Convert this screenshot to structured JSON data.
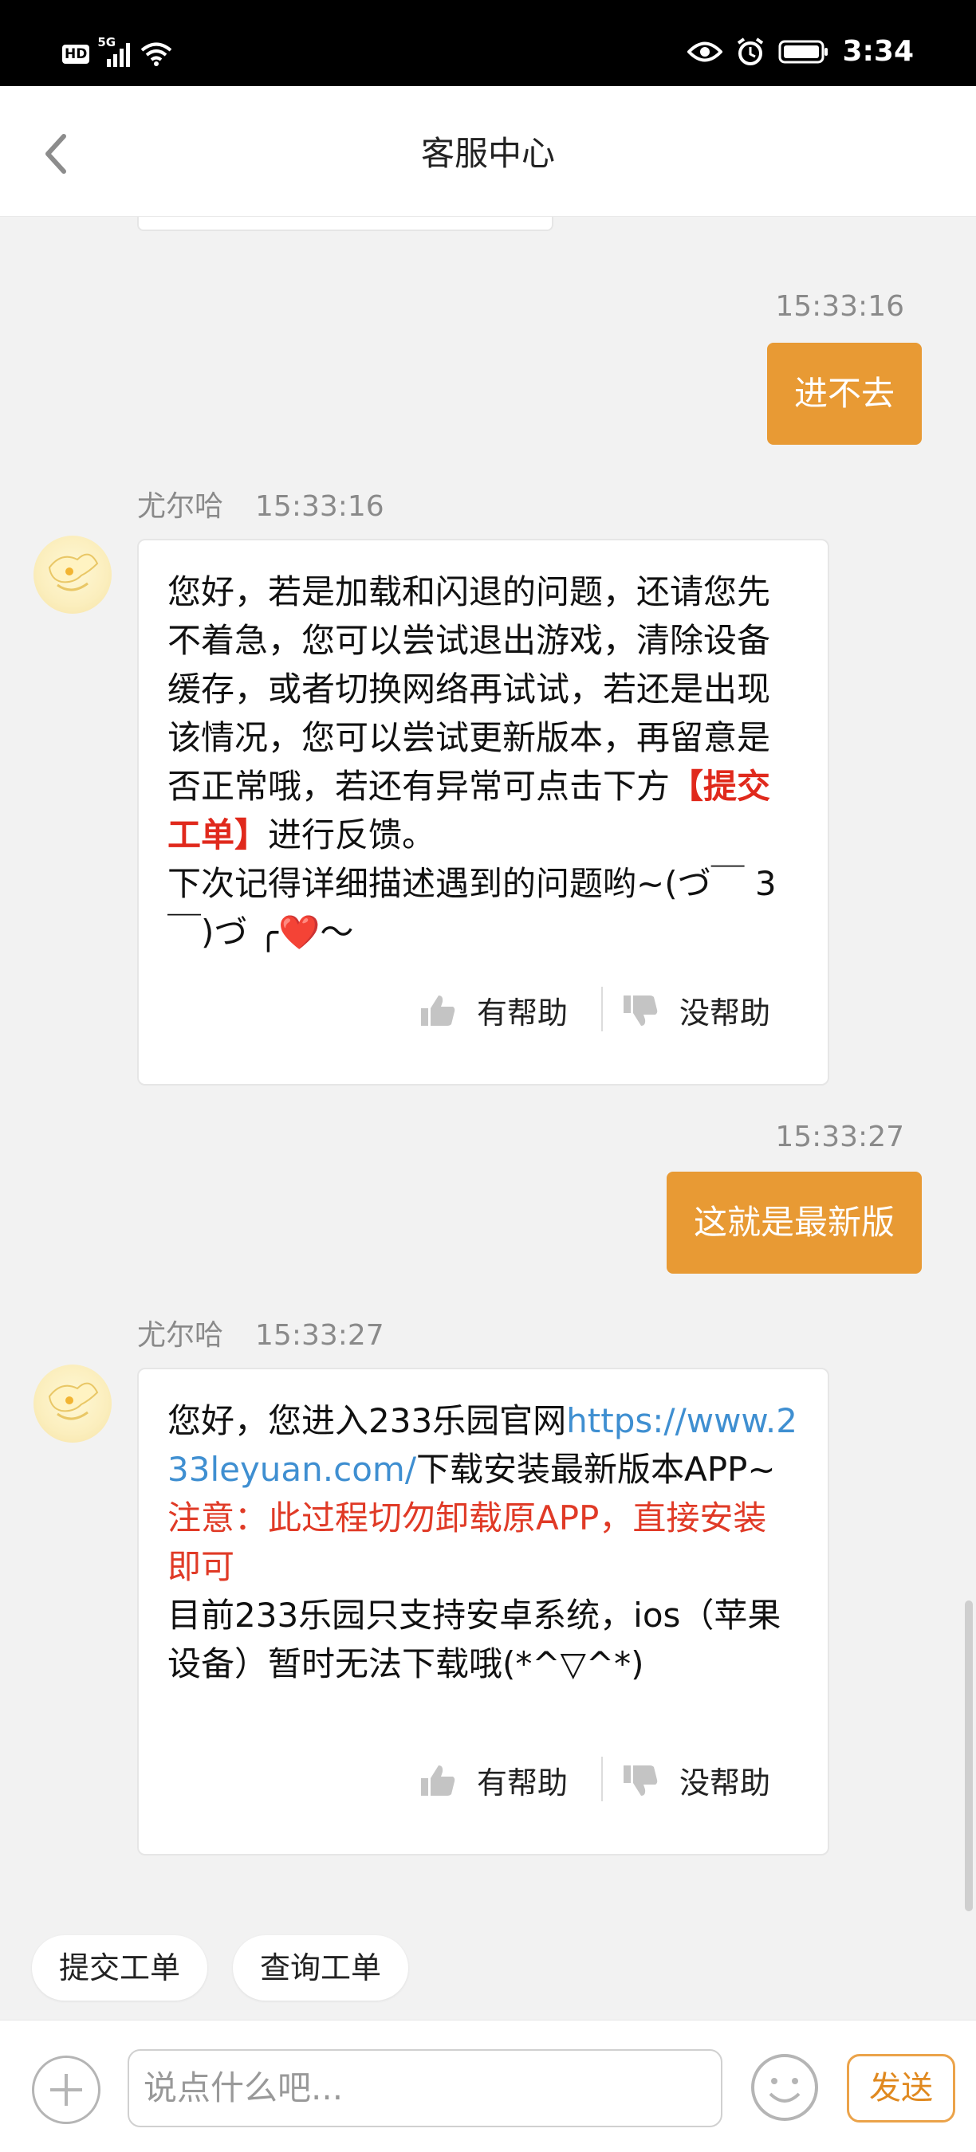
{
  "status_bar": {
    "hd": "HD",
    "network": "5G",
    "time": "3:34"
  },
  "header": {
    "title": "客服中心"
  },
  "messages": {
    "m1": {
      "time": "15:33:16",
      "text": "进不去"
    },
    "m2": {
      "sender": "尤尔哈",
      "time": "15:33:16",
      "p1": "您好，若是加载和闪退的问题，还请您先不着急，您可以尝试退出游戏，清除设备缓存，或者切换网络再试试，若还是出现该情况，您可以尝试更新版本，再留意是否正常哦，若还有异常可点击下方",
      "highlight": "【提交工单】",
      "p1_end": "进行反馈。",
      "p2": "下次记得详细描述遇到的问题哟~(づ￣ 3￣)づ ╭❤️～",
      "helpful": "有帮助",
      "unhelpful": "没帮助"
    },
    "m3": {
      "time": "15:33:27",
      "text": "这就是最新版"
    },
    "m4": {
      "sender": "尤尔哈",
      "time": "15:33:27",
      "p1_start": "您好，您进入233乐园官网",
      "link": "https://www.233leyuan.com/",
      "p1_end": "下载安装最新版本APP~",
      "warning": "注意：此过程切勿卸载原APP，直接安装即可",
      "p3": "目前233乐园只支持安卓系统，ios（苹果设备）暂时无法下载哦(*^▽^*)",
      "helpful": "有帮助",
      "unhelpful": "没帮助"
    }
  },
  "quick_actions": {
    "submit": "提交工单",
    "query": "查询工单"
  },
  "input": {
    "placeholder": "说点什么吧...",
    "send": "发送"
  },
  "colors": {
    "accent": "#e89a34",
    "highlight_red": "#e0291c",
    "link_blue": "#3f8fd1"
  }
}
